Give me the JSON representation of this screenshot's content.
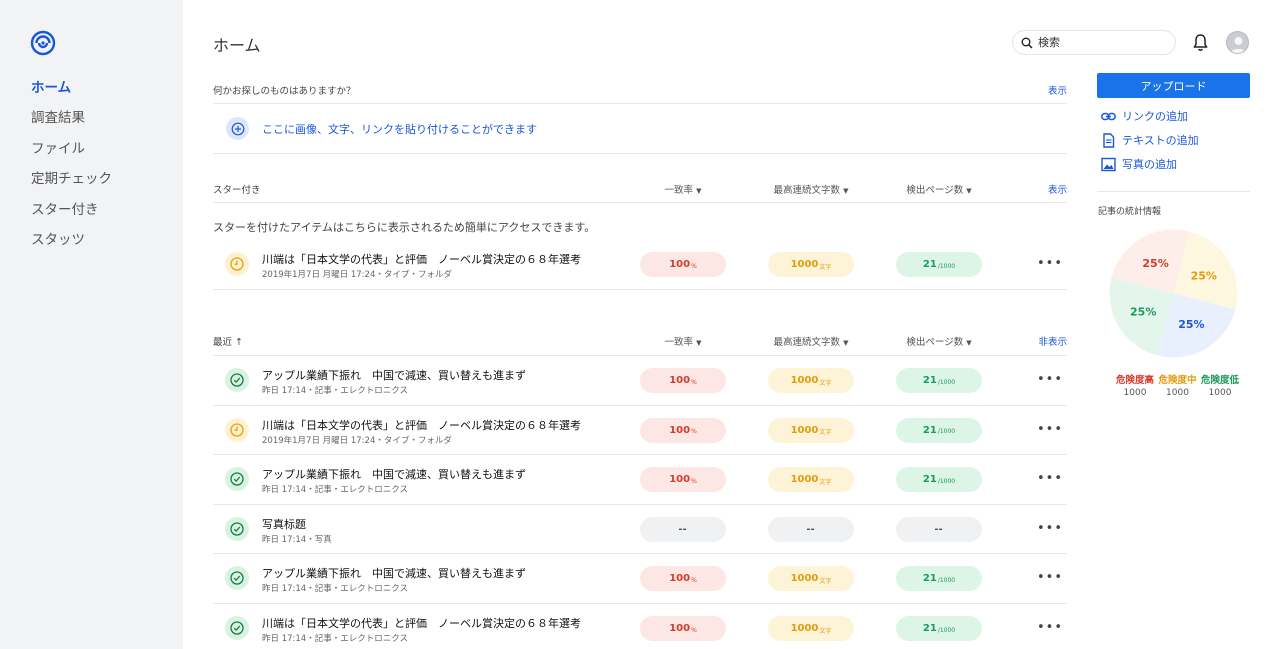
{
  "sidebar": {
    "items": [
      {
        "label": "ホーム",
        "active": true
      },
      {
        "label": "調査結果"
      },
      {
        "label": "ファイル"
      },
      {
        "label": "定期チェック"
      },
      {
        "label": "スター付き"
      },
      {
        "label": "スタッツ"
      }
    ]
  },
  "header": {
    "title": "ホーム",
    "search_placeholder": "検索"
  },
  "search_section": {
    "question": "何かお探しのものはありますか？",
    "show_link": "表示",
    "paste_hint": "ここに画像、文字、リンクを貼り付けることができます"
  },
  "columns": {
    "match_rate": "一致率",
    "max_consecutive": "最高連続文字数",
    "detected_pages": "検出ページ数"
  },
  "starred": {
    "label": "スター付き",
    "toggle": "表示",
    "info": "スターを付けたアイテムはこちらに表示されるため簡単にアクセスできます。",
    "rows": [
      {
        "status": "clock",
        "title": "川端は「日本文学の代表」と評価　ノーベル賞決定の６８年選考",
        "sub": "2019年1月7日 月曜日 17:24・タイプ・フォルダ",
        "match": "100",
        "match_unit": "%",
        "chars": "1000",
        "chars_unit": "文字",
        "pages": "21",
        "pages_unit": "/1000"
      }
    ]
  },
  "recent": {
    "label": "最近",
    "sort_arrow": "↑",
    "toggle": "非表示",
    "rows": [
      {
        "status": "ok",
        "title": "アップル業績下振れ　中国で減速、買い替えも進まず",
        "sub": "昨日 17:14・記事・エレクトロニクス",
        "match": "100",
        "match_unit": "%",
        "chars": "1000",
        "chars_unit": "文字",
        "pages": "21",
        "pages_unit": "/1000"
      },
      {
        "status": "clock",
        "title": "川端は「日本文学の代表」と評価　ノーベル賞決定の６８年選考",
        "sub": "2019年1月7日 月曜日 17:24・タイプ・フォルダ",
        "match": "100",
        "match_unit": "%",
        "chars": "1000",
        "chars_unit": "文字",
        "pages": "21",
        "pages_unit": "/1000"
      },
      {
        "status": "ok",
        "title": "アップル業績下振れ　中国で減速、買い替えも進まず",
        "sub": "昨日 17:14・記事・エレクトロニクス",
        "match": "100",
        "match_unit": "%",
        "chars": "1000",
        "chars_unit": "文字",
        "pages": "21",
        "pages_unit": "/1000"
      },
      {
        "status": "ok",
        "title": "写真标题",
        "sub": "昨日 17:14・写真",
        "match": "--",
        "match_unit": "",
        "chars": "--",
        "chars_unit": "",
        "pages": "--",
        "pages_unit": "",
        "empty": true
      },
      {
        "status": "ok",
        "title": "アップル業績下振れ　中国で減速、買い替えも進まず",
        "sub": "昨日 17:14・記事・エレクトロニクス",
        "match": "100",
        "match_unit": "%",
        "chars": "1000",
        "chars_unit": "文字",
        "pages": "21",
        "pages_unit": "/1000"
      },
      {
        "status": "ok",
        "title": "川端は「日本文学の代表」と評価　ノーベル賞決定の６８年選考",
        "sub": "昨日 17:14・記事・エレクトロニクス",
        "match": "100",
        "match_unit": "%",
        "chars": "1000",
        "chars_unit": "文字",
        "pages": "21",
        "pages_unit": "/1000"
      }
    ]
  },
  "more_label": "•••",
  "right_panel": {
    "upload": "アップロード",
    "actions": [
      {
        "label": "リンクの追加",
        "icon": "link-icon"
      },
      {
        "label": "テキストの追加",
        "icon": "document-icon"
      },
      {
        "label": "写真の追加",
        "icon": "image-icon"
      }
    ],
    "stats_title": "記事の統計情報",
    "pie": [
      {
        "label": "25%",
        "value": 25,
        "fill": "#fdeeea",
        "text": "#d63a2b"
      },
      {
        "label": "25%",
        "value": 25,
        "fill": "#fef7df",
        "text": "#e39b0c"
      },
      {
        "label": "25%",
        "value": 25,
        "fill": "#e9f0fd",
        "text": "#1a56db"
      },
      {
        "label": "25%",
        "value": 25,
        "fill": "#e4f6eb",
        "text": "#1d9a5b"
      }
    ],
    "legend": [
      {
        "label": "危険度高",
        "value": "1000",
        "color": "#d63a2b"
      },
      {
        "label": "危険度中",
        "value": "1000",
        "color": "#e39b0c"
      },
      {
        "label": "危険度低",
        "value": "1000",
        "color": "#1d9a5b"
      }
    ]
  },
  "colors": {
    "accent": "#1a56db",
    "upload_button": "#1a73e8"
  }
}
